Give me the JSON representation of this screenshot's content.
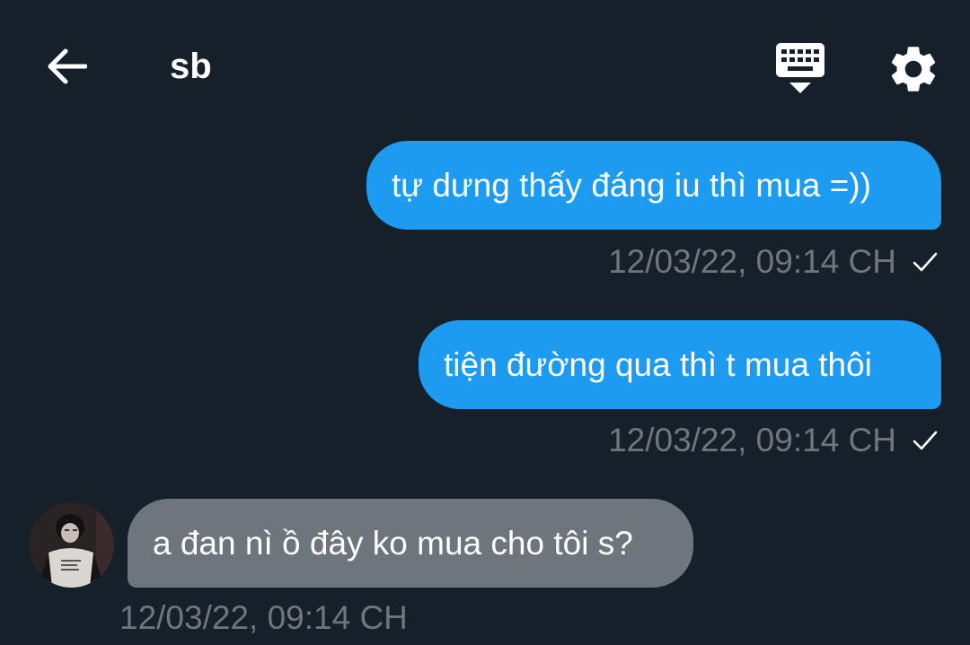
{
  "header": {
    "title": "sb",
    "back_icon": "arrow-left-icon",
    "keyboard_icon": "keyboard-icon",
    "settings_icon": "gear-icon"
  },
  "messages": [
    {
      "direction": "outgoing",
      "text": "tự dưng thấy đáng iu thì mua =))",
      "timestamp": "12/03/22, 09:14 CH",
      "status_icon": "check-icon"
    },
    {
      "direction": "outgoing",
      "text": "tiện đường qua thì t mua thôi",
      "timestamp": "12/03/22, 09:14 CH",
      "status_icon": "check-icon"
    },
    {
      "direction": "incoming",
      "text": "a đan nì ồ đây ko mua cho tôi s?",
      "timestamp": "12/03/22, 09:14 CH",
      "avatar": "avatar"
    }
  ],
  "colors": {
    "background": "#16202b",
    "outgoing_bubble": "#1d9bf0",
    "incoming_bubble": "#6e767d",
    "timestamp": "#71767b",
    "text": "#ffffff"
  }
}
